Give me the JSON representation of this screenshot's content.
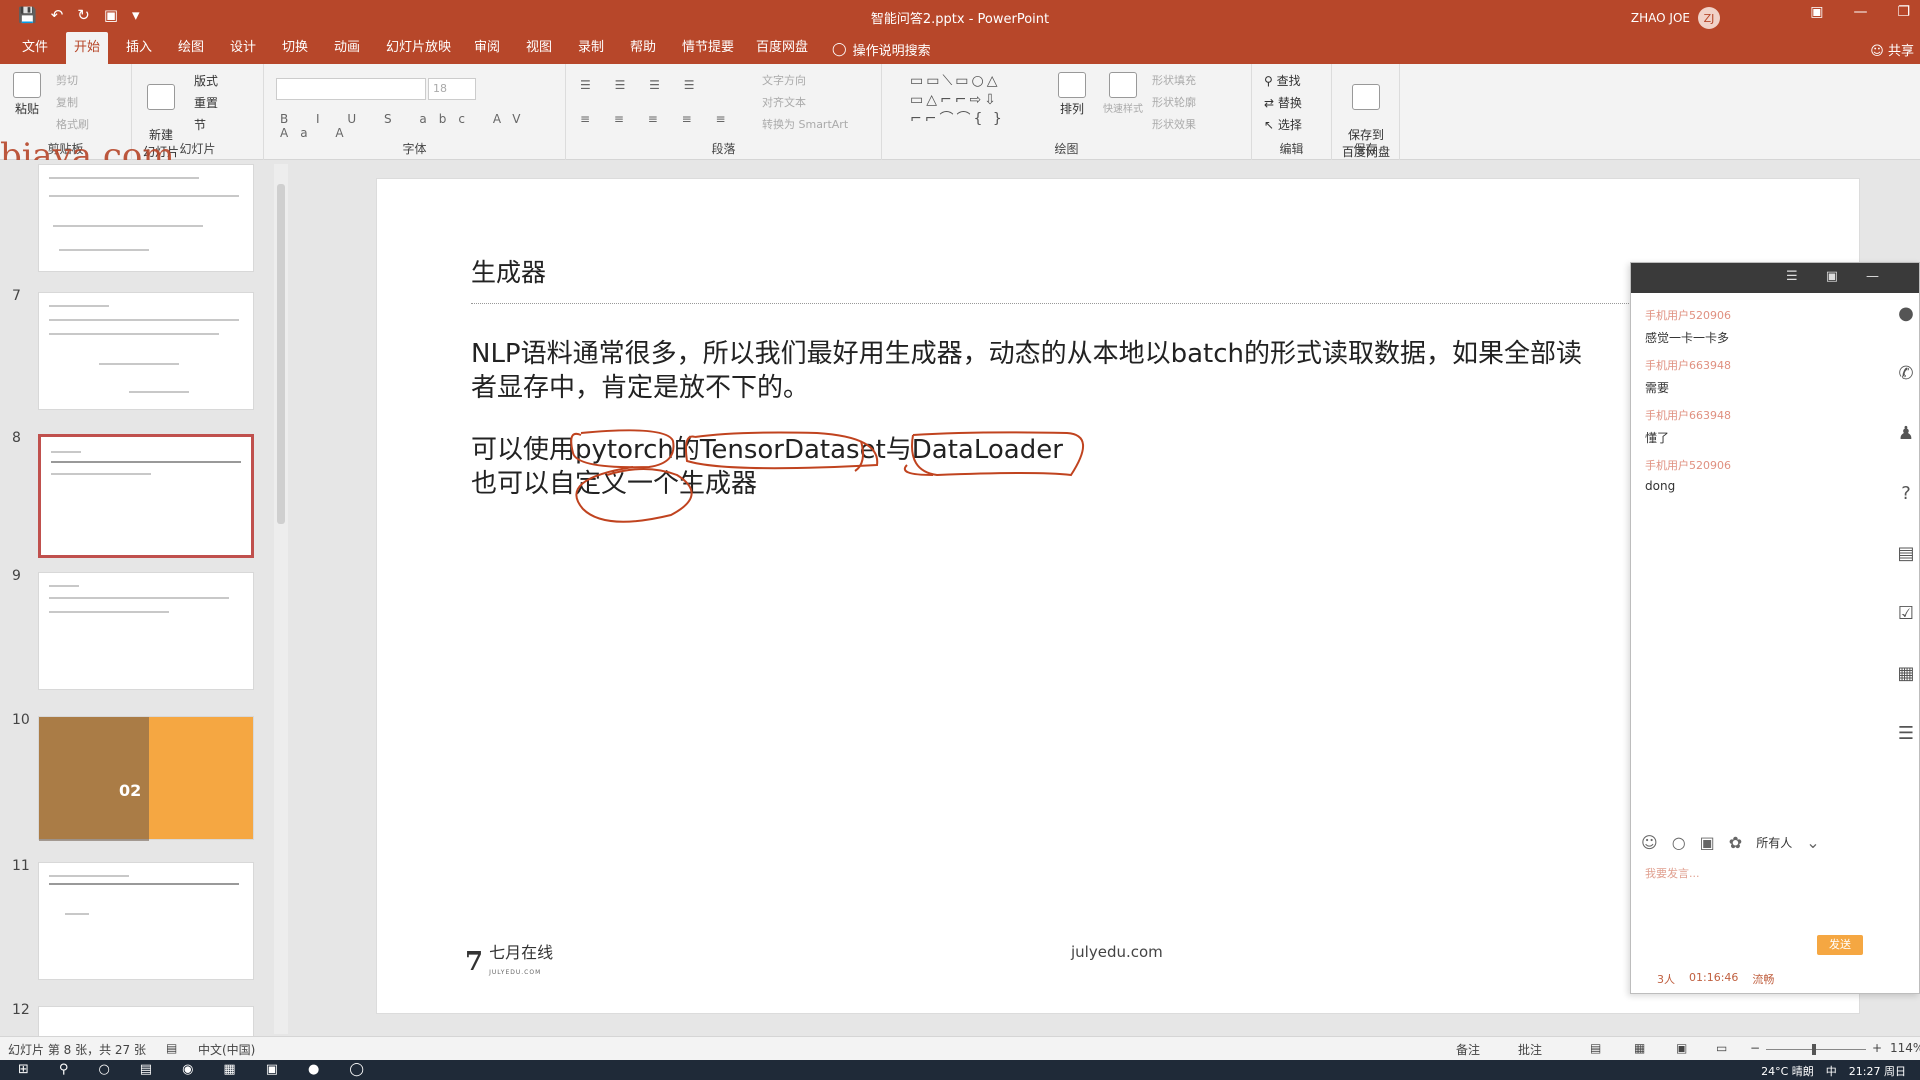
{
  "titlebar": {
    "doc_title": "智能问答2.pptx  -  PowerPoint",
    "user_name": "ZHAO JOE",
    "user_avatar": "ZJ",
    "qat_icons": [
      "save-icon",
      "undo-icon",
      "redo-icon",
      "slideshow-icon",
      "customize-icon"
    ]
  },
  "tabs": [
    "文件",
    "开始",
    "插入",
    "绘图",
    "设计",
    "切换",
    "动画",
    "幻灯片放映",
    "审阅",
    "视图",
    "录制",
    "帮助",
    "情节提要",
    "百度网盘"
  ],
  "active_tab": "开始",
  "tell_me": "操作说明搜索",
  "share": "共享",
  "ribbon": {
    "clipboard": {
      "label": "剪贴板",
      "paste": "粘贴",
      "cut": "剪切",
      "copy": "复制",
      "format_painter": "格式刷"
    },
    "slides": {
      "label": "幻灯片",
      "new_slide": "新建\n幻灯片",
      "layout": "版式",
      "reset": "重置",
      "section": "节"
    },
    "font": {
      "label": "字体",
      "size": "18"
    },
    "paragraph": {
      "label": "段落",
      "text_direction": "文字方向",
      "align_text": "对齐文本",
      "smartart": "转换为 SmartArt"
    },
    "drawing": {
      "label": "绘图",
      "arrange": "排列",
      "quick_styles": "快速样式",
      "shape_fill": "形状填充",
      "shape_outline": "形状轮廓",
      "shape_effects": "形状效果"
    },
    "editing": {
      "label": "编辑",
      "find": "查找",
      "replace": "替换",
      "select": "选择"
    },
    "save": {
      "label": "保存",
      "save_to": "保存到\n百度网盘"
    }
  },
  "watermark": "bjava.com",
  "thumbnails": [
    {
      "num": "",
      "kind": "text"
    },
    {
      "num": "7",
      "kind": "text"
    },
    {
      "num": "8",
      "kind": "selected"
    },
    {
      "num": "9",
      "kind": "text"
    },
    {
      "num": "10",
      "kind": "orange",
      "caption": "02"
    },
    {
      "num": "11",
      "kind": "text"
    },
    {
      "num": "12",
      "kind": "text"
    }
  ],
  "slide": {
    "title": "生成器",
    "para1_line1": "NLP语料通常很多，所以我们最好用生成器，动态的从本地以batch的形式读取数据，如果全部读",
    "para1_line2": "者显存中，肯定是放不下的。",
    "para2_line1": "可以使用pytorch的TensorDataset与DataLoader",
    "para2_line2": "也可以自定义一个生成器",
    "footer_logo": "七月在线",
    "footer_logo_sub": "JULYEDU.COM",
    "footer_url": "julyedu.com"
  },
  "chat": {
    "messages": [
      {
        "who": "手机用户520906",
        "text": "感觉一卡一卡多"
      },
      {
        "who": "手机用户663948",
        "text": "需要"
      },
      {
        "who": "手机用户663948",
        "text": "懂了"
      },
      {
        "who": "手机用户520906",
        "text": "dong"
      }
    ],
    "side_icons": [
      "chat-icon",
      "phone-icon",
      "user-icon",
      "question-icon",
      "notes-icon",
      "check-icon",
      "doc-icon",
      "list-icon"
    ],
    "recipient": "所有人",
    "input_placeholder": "我要发言...",
    "send": "发送",
    "status_count": "3人",
    "status_time": "01:16:46",
    "status_net": "流畅"
  },
  "statusbar": {
    "slide_info": "幻灯片 第 8 张，共 27 张",
    "language": "中文(中国)",
    "notes": "备注",
    "comments": "批注",
    "zoom": "114%"
  },
  "taskbar": {
    "weather": "24°C  晴朗",
    "ime": "中",
    "time": "21:27 周日"
  }
}
